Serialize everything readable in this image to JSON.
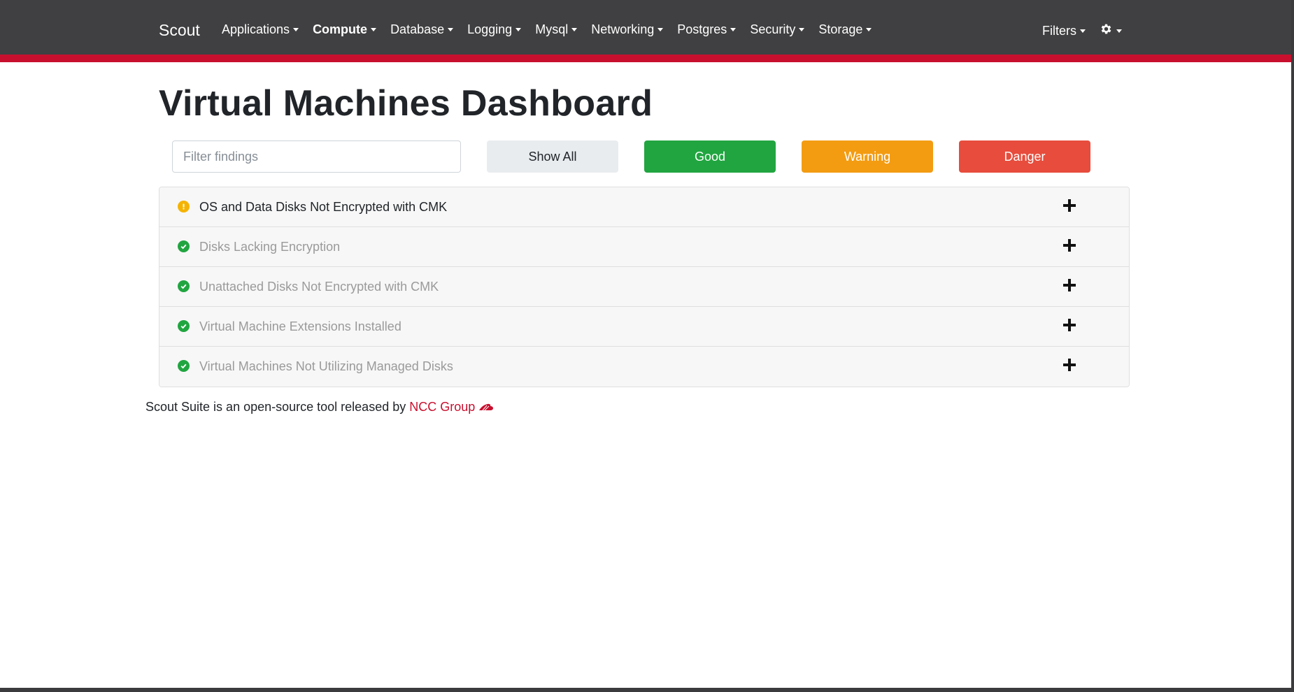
{
  "navbar": {
    "brand": "Scout",
    "items": [
      {
        "label": "Applications",
        "active": false
      },
      {
        "label": "Compute",
        "active": true
      },
      {
        "label": "Database",
        "active": false
      },
      {
        "label": "Logging",
        "active": false
      },
      {
        "label": "Mysql",
        "active": false
      },
      {
        "label": "Networking",
        "active": false
      },
      {
        "label": "Postgres",
        "active": false
      },
      {
        "label": "Security",
        "active": false
      },
      {
        "label": "Storage",
        "active": false
      }
    ],
    "filters_label": "Filters",
    "settings_icon": "gear-icon",
    "accent_color": "#c8102e"
  },
  "page": {
    "title": "Virtual Machines Dashboard"
  },
  "toolbar": {
    "filter_placeholder": "Filter findings",
    "show_all_label": "Show All",
    "good_label": "Good",
    "warning_label": "Warning",
    "danger_label": "Danger",
    "colors": {
      "good": "#21a540",
      "warning": "#f39c12",
      "danger": "#e74c3c"
    }
  },
  "findings": [
    {
      "title": "OS and Data Disks Not Encrypted with CMK",
      "status": "warning"
    },
    {
      "title": "Disks Lacking Encryption",
      "status": "good"
    },
    {
      "title": "Unattached Disks Not Encrypted with CMK",
      "status": "good"
    },
    {
      "title": "Virtual Machine Extensions Installed",
      "status": "good"
    },
    {
      "title": "Virtual Machines Not Utilizing Managed Disks",
      "status": "good"
    }
  ],
  "footer": {
    "text": "Scout Suite is an open-source tool released by ",
    "link_label": "NCC Group"
  }
}
